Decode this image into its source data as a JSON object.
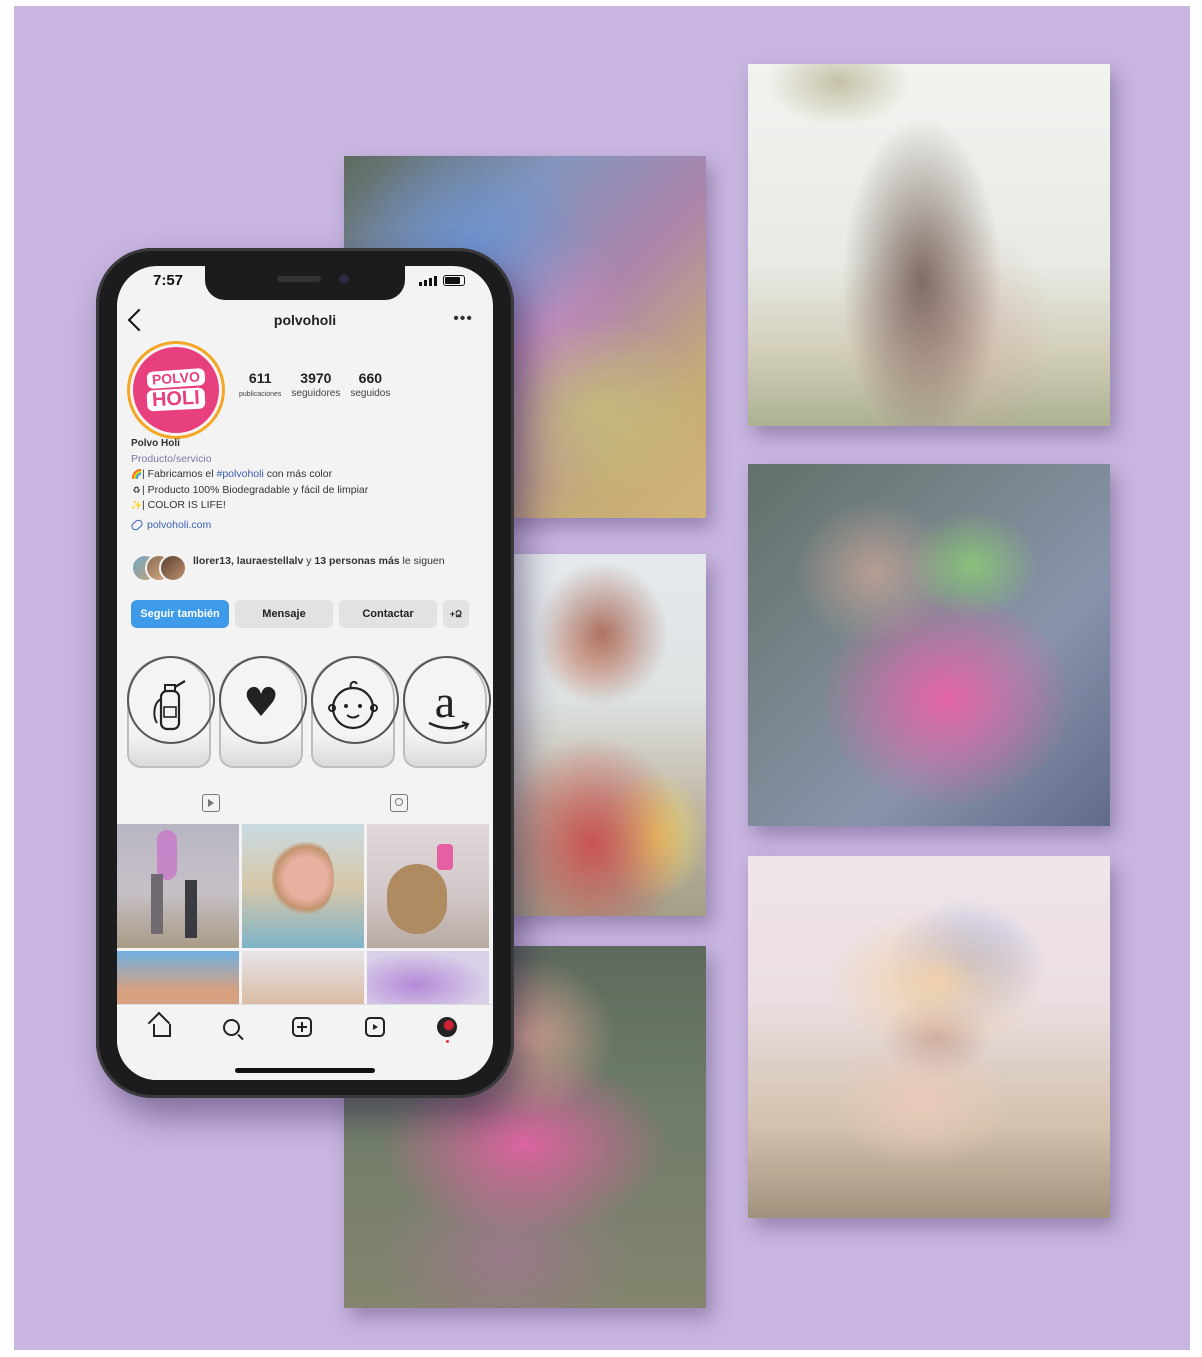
{
  "colors": {
    "background": "#c8b6e0",
    "accent": "#e8407f",
    "primary_button": "#3d9be9"
  },
  "status_bar": {
    "time": "7:57"
  },
  "profile": {
    "username": "polvoholi",
    "logo_line1": "POLVO",
    "logo_line2": "HOLI",
    "stats": [
      {
        "value": "611",
        "label": "publicaciones"
      },
      {
        "value": "3970",
        "label": "seguidores"
      },
      {
        "value": "660",
        "label": "seguidos"
      }
    ],
    "display_name": "Polvo Holi",
    "category": "Producto/servicio",
    "bio_line1_pre": "| Fabricamos el ",
    "bio_line1_tag": "#polvoholi",
    "bio_line1_post": " con más color",
    "bio_line2": "| Producto 100% Biodegradable y fácil de limpiar",
    "bio_line3": "| COLOR IS LIFE!",
    "website": "polvoholi.com",
    "followed_by_names": "llorer13, lauraestellalv",
    "followed_by_mid": " y ",
    "followed_by_count": "13 personas más",
    "followed_by_end": " le siguen"
  },
  "buttons": {
    "follow": "Seguir también",
    "message": "Mensaje",
    "contact": "Contactar",
    "add_user": "+Ձ"
  },
  "highlights": [
    {
      "icon": "fire-extinguisher-icon",
      "label": ""
    },
    {
      "icon": "heart-icon",
      "label": ""
    },
    {
      "icon": "baby-icon",
      "label": ""
    },
    {
      "icon": "amazon-icon",
      "label": ""
    }
  ],
  "icons": {
    "heart_glyph": "♥",
    "baby_glyph": "☺",
    "amazon_glyph": "a",
    "extinguisher_glyph": "⛽"
  }
}
